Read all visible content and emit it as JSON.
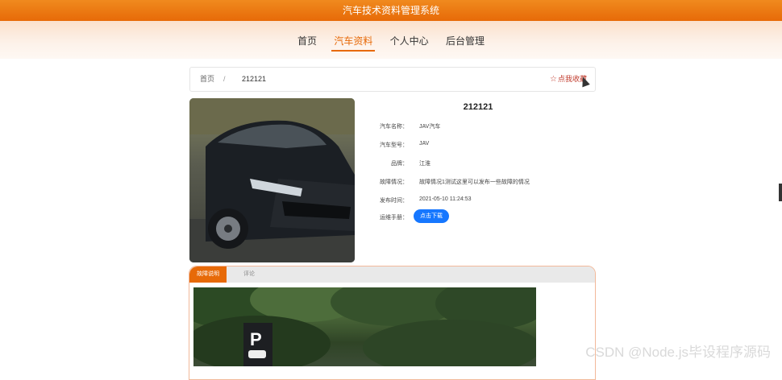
{
  "header": {
    "title": "汽车技术资料管理系统"
  },
  "nav": {
    "items": [
      "首页",
      "汽车资料",
      "个人中心",
      "后台管理"
    ],
    "active_index": 1
  },
  "breadcrumb": {
    "home": "首页",
    "separator": "/",
    "current": "212121",
    "favorite_label": "点我收藏",
    "favorite_icon": "star-outline-icon"
  },
  "detail": {
    "title": "212121",
    "fields": [
      {
        "label": "汽车名称：",
        "value": "JAV汽车"
      },
      {
        "label": "汽车型号：",
        "value": "JAV"
      },
      {
        "label": "品牌：",
        "value": "江淮"
      },
      {
        "label": "故障情况：",
        "value": "故障情况1测试这里可以发布一些故障的情况"
      },
      {
        "label": "发布时间：",
        "value": "2021-05-10 11:24:53"
      },
      {
        "label": "运维手册：",
        "value": ""
      }
    ],
    "download_label": "点击下载"
  },
  "tabs": {
    "items": [
      "故障说明",
      "评论"
    ],
    "active_index": 0
  },
  "parking_sign": {
    "letter": "P"
  },
  "watermark": "CSDN @Node.js毕设程序源码",
  "colors": {
    "accent": "#e76a08",
    "primary_button": "#1677ff",
    "favorite": "#c0392b"
  }
}
